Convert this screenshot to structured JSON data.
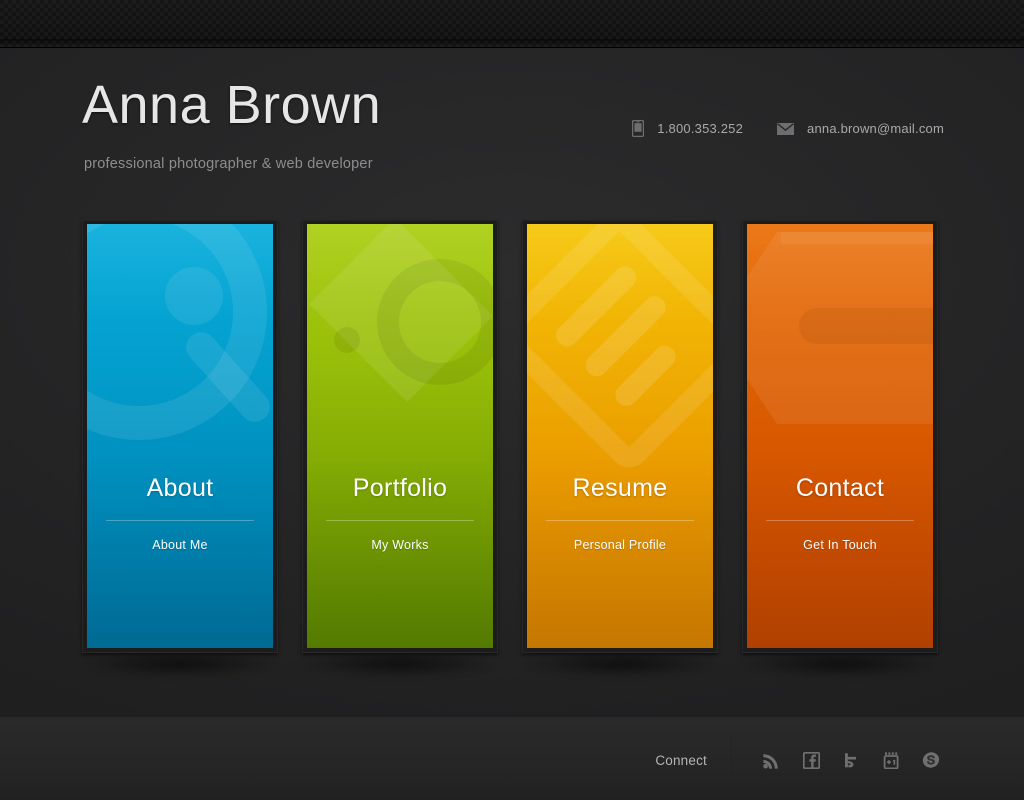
{
  "header": {
    "name": "Anna Brown",
    "tagline": "professional photographer & web developer",
    "contacts": [
      {
        "icon": "mobile-phone-icon",
        "text": "1.800.353.252"
      },
      {
        "icon": "envelope-icon",
        "text": "anna.brown@mail.com"
      }
    ]
  },
  "cards": [
    {
      "title": "About",
      "subtitle": "About Me",
      "watermark": "person-silhouette-icon",
      "color_top": "#00aada",
      "color_bottom": "#0079a8",
      "accent": "#0090bf"
    },
    {
      "title": "Portfolio",
      "subtitle": "My Works",
      "watermark": "camera-icon",
      "color_top": "#a8cc0a",
      "color_bottom": "#5f8b00",
      "accent": "#80aa00"
    },
    {
      "title": "Resume",
      "subtitle": "Personal Profile",
      "watermark": "document-list-icon",
      "color_top": "#f5c400",
      "color_bottom": "#e08700",
      "accent": "#eda200"
    },
    {
      "title": "Contact",
      "subtitle": "Get In Touch",
      "watermark": "envelope-icon",
      "color_top": "#e96a00",
      "color_bottom": "#c94900",
      "accent": "#d85600"
    }
  ],
  "footer": {
    "connect_label": "Connect",
    "social": [
      {
        "name": "rss-icon",
        "title": "RSS"
      },
      {
        "name": "facebook-icon",
        "title": "Facebook"
      },
      {
        "name": "twitter-icon",
        "title": "Twitter"
      },
      {
        "name": "google-plus-one-icon",
        "title": "+1"
      },
      {
        "name": "skype-icon",
        "title": "Skype"
      }
    ]
  },
  "theme": {
    "background": "#262627",
    "topbar": "#121213",
    "text_primary": "#e6e6e6",
    "text_muted": "#8d8d8d"
  }
}
